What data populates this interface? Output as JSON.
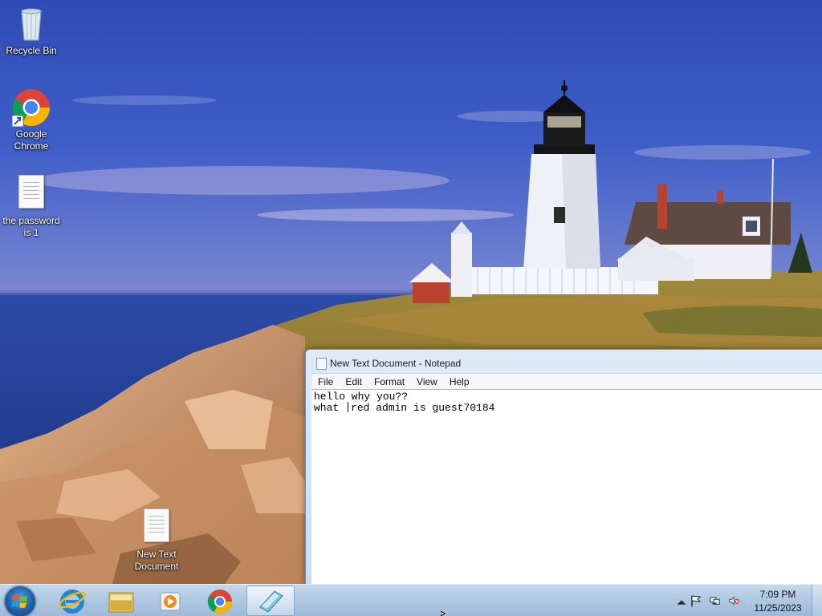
{
  "desktop": {
    "icons": [
      {
        "name": "Recycle Bin",
        "line1": "Recycle Bin",
        "line2": ""
      },
      {
        "name": "Google Chrome",
        "line1": "Google",
        "line2": "Chrome"
      },
      {
        "name": "the password is 1",
        "line1": "the password",
        "line2": "is 1"
      },
      {
        "name": "New Text Document",
        "line1": "New Text",
        "line2": "Document"
      }
    ]
  },
  "notepad": {
    "title": "New Text Document - Notepad",
    "menu": [
      "File",
      "Edit",
      "Format",
      "View",
      "Help"
    ],
    "lines": [
      "hello why you??",
      "what ",
      "red admin is guest70184"
    ]
  },
  "taskbar": {
    "pinned": [
      "start-orb-icon",
      "internet-explorer-icon",
      "file-explorer-icon",
      "media-player-icon",
      "google-chrome-icon",
      "notepad-icon"
    ],
    "clock": {
      "time": "7:09 PM",
      "date": "11/25/2023"
    },
    "tray_icons": [
      "show-hidden-icons-chevron-icon",
      "action-center-flag-icon",
      "network-icon",
      "volume-muted-icon"
    ]
  },
  "colors": {
    "sky_top": "#2f4bb6",
    "sea": "#1f3d8f",
    "taskbar": "#b0c9e3",
    "notepad_frame": "#c9dcef"
  }
}
